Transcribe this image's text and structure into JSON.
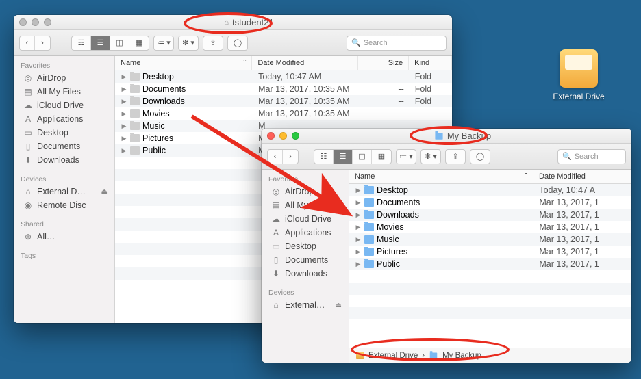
{
  "desktop_drive": {
    "label": "External Drive"
  },
  "window1": {
    "title": "tstudent21",
    "search_placeholder": "Search",
    "sidebar": {
      "favorites_heading": "Favorites",
      "favorites": [
        {
          "label": "AirDrop",
          "icon": "◎"
        },
        {
          "label": "All My Files",
          "icon": "▤"
        },
        {
          "label": "iCloud Drive",
          "icon": "☁"
        },
        {
          "label": "Applications",
          "icon": "A"
        },
        {
          "label": "Desktop",
          "icon": "▭"
        },
        {
          "label": "Documents",
          "icon": "▯"
        },
        {
          "label": "Downloads",
          "icon": "⬇"
        }
      ],
      "devices_heading": "Devices",
      "devices": [
        {
          "label": "External D…",
          "icon": "⌂",
          "eject": true
        },
        {
          "label": "Remote Disc",
          "icon": "◉"
        }
      ],
      "shared_heading": "Shared",
      "shared": [
        {
          "label": "All…",
          "icon": "⊕"
        }
      ],
      "tags_heading": "Tags"
    },
    "columns": {
      "name": "Name",
      "date": "Date Modified",
      "size": "Size",
      "kind": "Kind"
    },
    "rows": [
      {
        "name": "Desktop",
        "date": "Today, 10:47 AM",
        "size": "--",
        "kind": "Fold"
      },
      {
        "name": "Documents",
        "date": "Mar 13, 2017, 10:35 AM",
        "size": "--",
        "kind": "Fold"
      },
      {
        "name": "Downloads",
        "date": "Mar 13, 2017, 10:35 AM",
        "size": "--",
        "kind": "Fold"
      },
      {
        "name": "Movies",
        "date": "Mar 13, 2017, 10:35 AM",
        "size": "",
        "kind": ""
      },
      {
        "name": "Music",
        "date": "M",
        "size": "",
        "kind": ""
      },
      {
        "name": "Pictures",
        "date": "M",
        "size": "",
        "kind": ""
      },
      {
        "name": "Public",
        "date": "M",
        "size": "",
        "kind": ""
      }
    ]
  },
  "window2": {
    "title": "My Backup",
    "search_placeholder": "Search",
    "sidebar": {
      "favorites_heading": "Favorites",
      "favorites": [
        {
          "label": "AirDrop",
          "icon": "◎"
        },
        {
          "label": "All My Files",
          "icon": "▤"
        },
        {
          "label": "iCloud Drive",
          "icon": "☁"
        },
        {
          "label": "Applications",
          "icon": "A"
        },
        {
          "label": "Desktop",
          "icon": "▭"
        },
        {
          "label": "Documents",
          "icon": "▯"
        },
        {
          "label": "Downloads",
          "icon": "⬇"
        }
      ],
      "devices_heading": "Devices",
      "devices": [
        {
          "label": "External…",
          "icon": "⌂",
          "eject": true
        }
      ]
    },
    "columns": {
      "name": "Name",
      "date": "Date Modified"
    },
    "rows": [
      {
        "name": "Desktop",
        "date": "Today, 10:47 A"
      },
      {
        "name": "Documents",
        "date": "Mar 13, 2017, 1"
      },
      {
        "name": "Downloads",
        "date": "Mar 13, 2017, 1"
      },
      {
        "name": "Movies",
        "date": "Mar 13, 2017, 1"
      },
      {
        "name": "Music",
        "date": "Mar 13, 2017, 1"
      },
      {
        "name": "Pictures",
        "date": "Mar 13, 2017, 1"
      },
      {
        "name": "Public",
        "date": "Mar 13, 2017, 1"
      }
    ],
    "pathbar": {
      "drive": "External Drive",
      "folder": "My Backup"
    }
  }
}
